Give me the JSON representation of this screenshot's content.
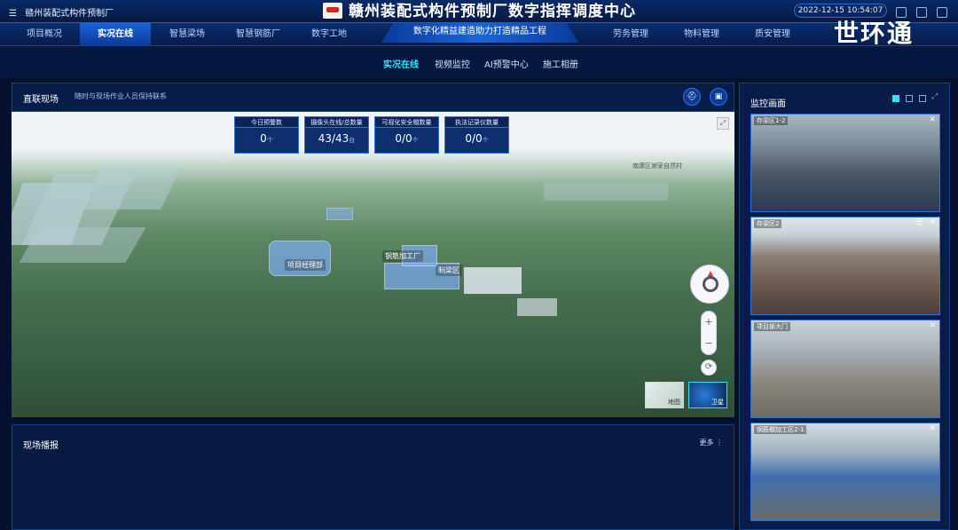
{
  "header": {
    "org_name": "赣州装配式构件预制厂",
    "title": "赣州装配式构件预制厂数字指挥调度中心",
    "datetime": "2022-12-15 10:54:07",
    "banner": "数字化精益建造助力打造精品工程",
    "watermark": "世环通"
  },
  "nav": {
    "items": [
      "项目概况",
      "实况在线",
      "智慧梁场",
      "智慧钢筋厂",
      "数字工地",
      "劳务管理",
      "物料管理",
      "质安管理"
    ],
    "active": "实况在线"
  },
  "subnav": {
    "items": [
      "实况在线",
      "视频监控",
      "AI预警中心",
      "施工相册"
    ],
    "active": "实况在线"
  },
  "live": {
    "title": "直联现场",
    "subtitle": "随时与现场作业人员保持联系"
  },
  "stats": [
    {
      "label": "今日预警数",
      "value": "0",
      "unit": "个"
    },
    {
      "label": "摄像头在线/总数量",
      "value": "43/43",
      "unit": "台"
    },
    {
      "label": "可视化安全帽数量",
      "value": "0/0",
      "unit": "个"
    },
    {
      "label": "执法记录仪数量",
      "value": "0/0",
      "unit": "个"
    }
  ],
  "map": {
    "labels": [
      "项目经理部",
      "钢筋加工厂",
      "制梁区"
    ],
    "top_label": "南康区谢家自然村",
    "map_types": [
      "地图",
      "卫星"
    ],
    "active_type": "卫星",
    "zoom_in": "+",
    "zoom_out": "−",
    "expand_symbol": "⤢",
    "refresh_symbol": "⟳"
  },
  "report": {
    "title": "现场播报",
    "more": "更多 ⋮"
  },
  "monitor": {
    "title": "监控画面",
    "cameras": [
      {
        "label": "存梁区1-2"
      },
      {
        "label": "存梁区2"
      },
      {
        "label": "项目部大门"
      },
      {
        "label": "钢筋棚加工区2-1"
      }
    ],
    "close_symbol": "✕",
    "menu_symbol": "☰"
  },
  "colors": {
    "accent": "#2ee3ff",
    "panel_bg": "#071c48",
    "nav_active": "#1a62d8"
  }
}
